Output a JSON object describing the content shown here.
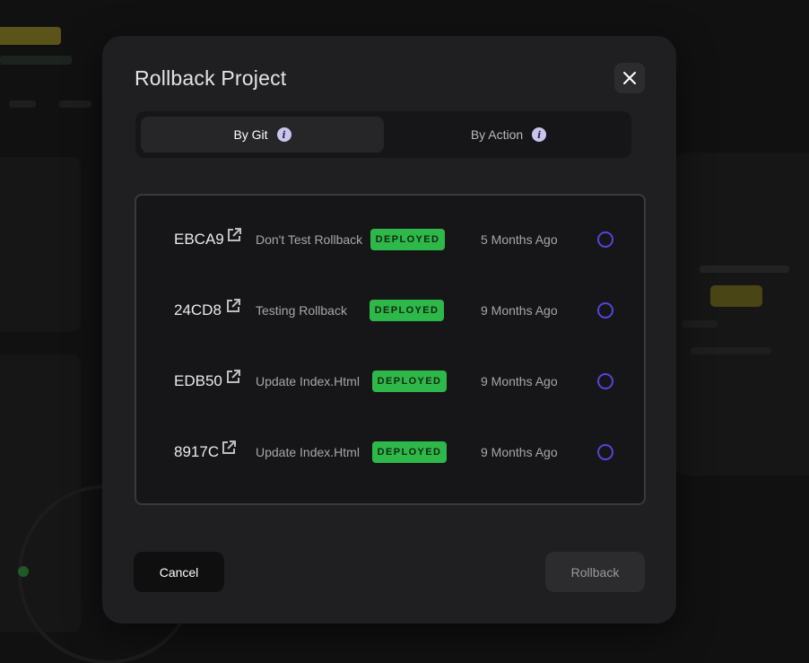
{
  "modal": {
    "title": "Rollback Project",
    "close_icon": "close-icon"
  },
  "tabs": [
    {
      "label": "By Git",
      "active": true,
      "icon": "info-icon"
    },
    {
      "label": "By Action",
      "active": false,
      "icon": "info-icon"
    }
  ],
  "commits": [
    {
      "id": "EBCA9",
      "message": "Don't Test Rollback",
      "status": "DEPLOYED",
      "time": "5 Months Ago"
    },
    {
      "id": "24CD8",
      "message": "Testing Rollback",
      "status": "DEPLOYED",
      "time": "9 Months Ago"
    },
    {
      "id": "EDB50",
      "message": "Update Index.Html",
      "status": "DEPLOYED",
      "time": "9 Months Ago"
    },
    {
      "id": "8917C",
      "message": "Update Index.Html",
      "status": "DEPLOYED",
      "time": "9 Months Ago"
    }
  ],
  "footer": {
    "cancel_label": "Cancel",
    "rollback_label": "Rollback"
  },
  "colors": {
    "modal_bg": "#1f1f21",
    "badge_green": "#2fb84a",
    "radio_accent": "#5544dd"
  }
}
